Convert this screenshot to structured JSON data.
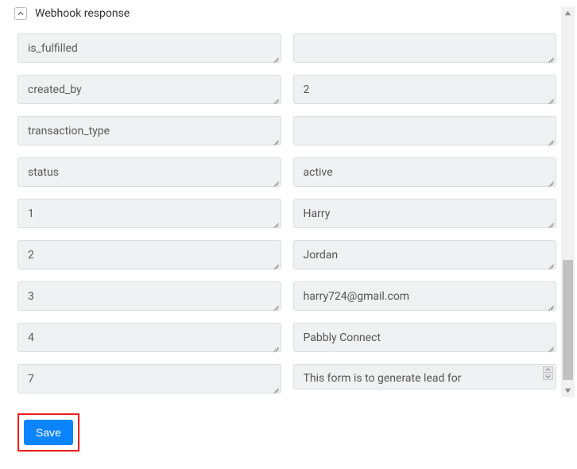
{
  "header": {
    "title": "Webhook response"
  },
  "rows": [
    {
      "key": "is_fulfilled",
      "value": ""
    },
    {
      "key": "created_by",
      "value": "2"
    },
    {
      "key": "transaction_type",
      "value": ""
    },
    {
      "key": "status",
      "value": "active"
    },
    {
      "key": "1",
      "value": "Harry"
    },
    {
      "key": "2",
      "value": "Jordan"
    },
    {
      "key": "3",
      "value": "harry724@gmail.com"
    },
    {
      "key": "4",
      "value": "Pabbly Connect"
    },
    {
      "key": "7",
      "value": "This form is to generate lead for"
    }
  ],
  "actions": {
    "save_label": "Save"
  }
}
